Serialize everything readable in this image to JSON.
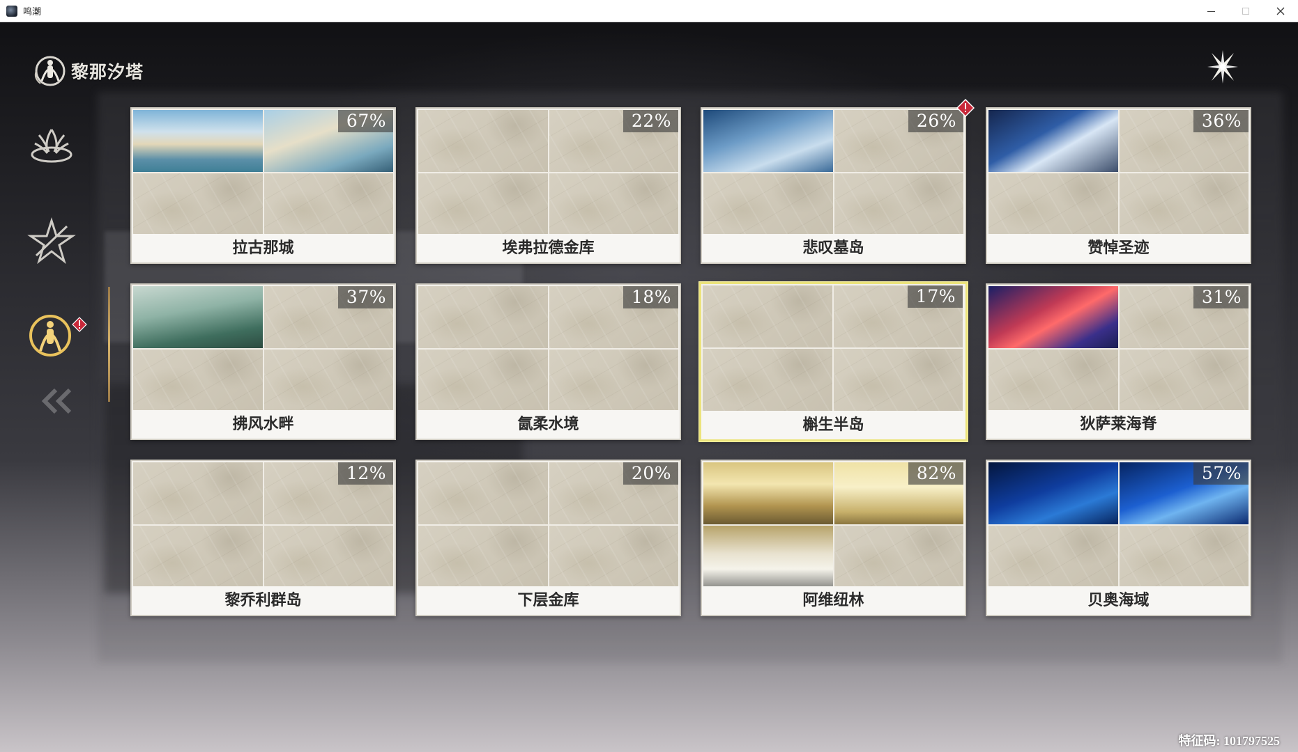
{
  "window": {
    "title": "鸣潮",
    "minimize_icon": "minimize-icon",
    "maximize_icon": "maximize-icon",
    "close_icon": "close-icon"
  },
  "header": {
    "title": "黎那汐塔",
    "close_icon": "close-x-icon"
  },
  "sidebar": {
    "items": [
      {
        "icon": "dragon-emblem-icon",
        "active": false
      },
      {
        "icon": "star-crest-icon",
        "active": false
      },
      {
        "icon": "rinascita-emblem-icon",
        "active": true,
        "alert": true
      }
    ],
    "collapse_icon": "double-chevron-left-icon"
  },
  "regions": [
    {
      "name": "拉古那城",
      "progress": "67%",
      "alert": false,
      "selected": false
    },
    {
      "name": "埃弗拉德金库",
      "progress": "22%",
      "alert": false,
      "selected": false
    },
    {
      "name": "悲叹墓岛",
      "progress": "26%",
      "alert": true,
      "selected": false
    },
    {
      "name": "赞悼圣迹",
      "progress": "36%",
      "alert": false,
      "selected": false
    },
    {
      "name": "拂风水畔",
      "progress": "37%",
      "alert": false,
      "selected": false
    },
    {
      "name": "氤柔水境",
      "progress": "18%",
      "alert": false,
      "selected": false
    },
    {
      "name": "槲生半岛",
      "progress": "17%",
      "alert": false,
      "selected": true
    },
    {
      "name": "狄萨莱海脊",
      "progress": "31%",
      "alert": false,
      "selected": false
    },
    {
      "name": "黎乔利群岛",
      "progress": "12%",
      "alert": false,
      "selected": false
    },
    {
      "name": "下层金库",
      "progress": "20%",
      "alert": false,
      "selected": false
    },
    {
      "name": "阿维纽林",
      "progress": "82%",
      "alert": false,
      "selected": false
    },
    {
      "name": "贝奥海域",
      "progress": "57%",
      "alert": false,
      "selected": false
    }
  ],
  "footer": {
    "feature_code": "特征码: 101797525"
  },
  "colors": {
    "selected_border": "#ece47c",
    "alert_red": "#c8283a",
    "accent_gold": "#d8b46c"
  }
}
